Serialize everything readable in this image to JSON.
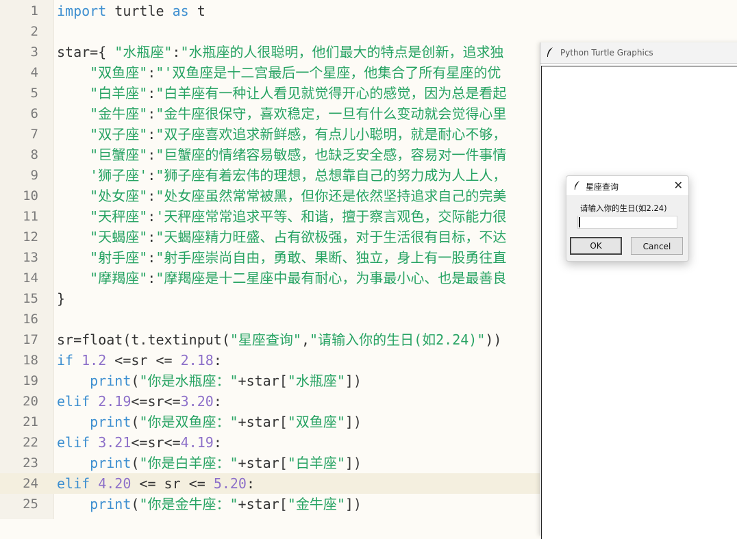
{
  "editor": {
    "lines": [
      {
        "num": "1",
        "segs": [
          {
            "t": "import",
            "c": "k"
          },
          {
            "t": " turtle ",
            "c": "p"
          },
          {
            "t": "as",
            "c": "k"
          },
          {
            "t": " t",
            "c": "p"
          }
        ]
      },
      {
        "num": "2",
        "segs": []
      },
      {
        "num": "3",
        "segs": [
          {
            "t": "star={ ",
            "c": "p"
          },
          {
            "t": "\"水瓶座\"",
            "c": "s"
          },
          {
            "t": ":",
            "c": "p"
          },
          {
            "t": "\"水瓶座的人很聪明，他们最大的特点是创新，追求独",
            "c": "s"
          }
        ]
      },
      {
        "num": "4",
        "segs": [
          {
            "t": "    ",
            "c": "p"
          },
          {
            "t": "\"双鱼座\"",
            "c": "s"
          },
          {
            "t": ":",
            "c": "p"
          },
          {
            "t": "\"'双鱼座是十二宫最后一个星座，他集合了所有星座的优",
            "c": "s"
          }
        ]
      },
      {
        "num": "5",
        "segs": [
          {
            "t": "    ",
            "c": "p"
          },
          {
            "t": "\"白羊座\"",
            "c": "s"
          },
          {
            "t": ":",
            "c": "p"
          },
          {
            "t": "\"白羊座有一种让人看见就觉得开心的感觉，因为总是看起",
            "c": "s"
          }
        ]
      },
      {
        "num": "6",
        "segs": [
          {
            "t": "    ",
            "c": "p"
          },
          {
            "t": "\"金牛座\"",
            "c": "s"
          },
          {
            "t": ":",
            "c": "p"
          },
          {
            "t": "\"金牛座很保守，喜欢稳定，一旦有什么变动就会觉得心里",
            "c": "s"
          }
        ]
      },
      {
        "num": "7",
        "segs": [
          {
            "t": "    ",
            "c": "p"
          },
          {
            "t": "\"双子座\"",
            "c": "s"
          },
          {
            "t": ":",
            "c": "p"
          },
          {
            "t": "\"双子座喜欢追求新鲜感，有点儿小聪明，就是耐心不够，",
            "c": "s"
          }
        ]
      },
      {
        "num": "8",
        "segs": [
          {
            "t": "    ",
            "c": "p"
          },
          {
            "t": "\"巨蟹座\"",
            "c": "s"
          },
          {
            "t": ":",
            "c": "p"
          },
          {
            "t": "\"巨蟹座的情绪容易敏感，也缺乏安全感，容易对一件事情",
            "c": "s"
          }
        ]
      },
      {
        "num": "9",
        "segs": [
          {
            "t": "    ",
            "c": "p"
          },
          {
            "t": "'狮子座'",
            "c": "s"
          },
          {
            "t": ":",
            "c": "p"
          },
          {
            "t": "\"狮子座有着宏伟的理想，总想靠自己的努力成为人上人，",
            "c": "s"
          }
        ]
      },
      {
        "num": "10",
        "segs": [
          {
            "t": "    ",
            "c": "p"
          },
          {
            "t": "\"处女座\"",
            "c": "s"
          },
          {
            "t": ":",
            "c": "p"
          },
          {
            "t": "\"处女座虽然常常被黑，但你还是依然坚持追求自己的完美",
            "c": "s"
          }
        ]
      },
      {
        "num": "11",
        "segs": [
          {
            "t": "    ",
            "c": "p"
          },
          {
            "t": "\"天秤座\"",
            "c": "s"
          },
          {
            "t": ":",
            "c": "p"
          },
          {
            "t": "'天秤座常常追求平等、和谐，擅于察言观色，交际能力很",
            "c": "s"
          }
        ]
      },
      {
        "num": "12",
        "segs": [
          {
            "t": "    ",
            "c": "p"
          },
          {
            "t": "\"天蝎座\"",
            "c": "s"
          },
          {
            "t": ":",
            "c": "p"
          },
          {
            "t": "\"天蝎座精力旺盛、占有欲极强，对于生活很有目标，不达",
            "c": "s"
          }
        ]
      },
      {
        "num": "13",
        "segs": [
          {
            "t": "    ",
            "c": "p"
          },
          {
            "t": "\"射手座\"",
            "c": "s"
          },
          {
            "t": ":",
            "c": "p"
          },
          {
            "t": "\"射手座崇尚自由，勇敢、果断、独立，身上有一股勇往直",
            "c": "s"
          }
        ]
      },
      {
        "num": "14",
        "segs": [
          {
            "t": "    ",
            "c": "p"
          },
          {
            "t": "\"摩羯座\"",
            "c": "s"
          },
          {
            "t": ":",
            "c": "p"
          },
          {
            "t": "\"摩羯座是十二星座中最有耐心，为事最小心、也是最善良",
            "c": "s"
          }
        ]
      },
      {
        "num": "15",
        "segs": [
          {
            "t": "}",
            "c": "p"
          }
        ]
      },
      {
        "num": "16",
        "segs": []
      },
      {
        "num": "17",
        "segs": [
          {
            "t": "sr=",
            "c": "p"
          },
          {
            "t": "float",
            "c": "f"
          },
          {
            "t": "(t.textinput(",
            "c": "p"
          },
          {
            "t": "\"星座查询\"",
            "c": "s"
          },
          {
            "t": ",",
            "c": "p"
          },
          {
            "t": "\"请输入你的生日(如2.24)\"",
            "c": "s"
          },
          {
            "t": "))",
            "c": "p"
          }
        ]
      },
      {
        "num": "18",
        "segs": [
          {
            "t": "if",
            "c": "k"
          },
          {
            "t": " ",
            "c": "p"
          },
          {
            "t": "1.2",
            "c": "n"
          },
          {
            "t": " <=sr <= ",
            "c": "p"
          },
          {
            "t": "2.18",
            "c": "n"
          },
          {
            "t": ":",
            "c": "p"
          }
        ]
      },
      {
        "num": "19",
        "segs": [
          {
            "t": "    ",
            "c": "p"
          },
          {
            "t": "print",
            "c": "k"
          },
          {
            "t": "(",
            "c": "p"
          },
          {
            "t": "\"你是水瓶座：\"",
            "c": "s"
          },
          {
            "t": "+star[",
            "c": "p"
          },
          {
            "t": "\"水瓶座\"",
            "c": "s"
          },
          {
            "t": "])",
            "c": "p"
          }
        ]
      },
      {
        "num": "20",
        "segs": [
          {
            "t": "elif",
            "c": "k"
          },
          {
            "t": " ",
            "c": "p"
          },
          {
            "t": "2.19",
            "c": "n"
          },
          {
            "t": "<=sr<=",
            "c": "p"
          },
          {
            "t": "3.20",
            "c": "n"
          },
          {
            "t": ":",
            "c": "p"
          }
        ]
      },
      {
        "num": "21",
        "segs": [
          {
            "t": "    ",
            "c": "p"
          },
          {
            "t": "print",
            "c": "k"
          },
          {
            "t": "(",
            "c": "p"
          },
          {
            "t": "\"你是双鱼座：\"",
            "c": "s"
          },
          {
            "t": "+star[",
            "c": "p"
          },
          {
            "t": "\"双鱼座\"",
            "c": "s"
          },
          {
            "t": "])",
            "c": "p"
          }
        ]
      },
      {
        "num": "22",
        "segs": [
          {
            "t": "elif",
            "c": "k"
          },
          {
            "t": " ",
            "c": "p"
          },
          {
            "t": "3.21",
            "c": "n"
          },
          {
            "t": "<=sr<=",
            "c": "p"
          },
          {
            "t": "4.19",
            "c": "n"
          },
          {
            "t": ":",
            "c": "p"
          }
        ]
      },
      {
        "num": "23",
        "segs": [
          {
            "t": "    ",
            "c": "p"
          },
          {
            "t": "print",
            "c": "k"
          },
          {
            "t": "(",
            "c": "p"
          },
          {
            "t": "\"你是白羊座：\"",
            "c": "s"
          },
          {
            "t": "+star[",
            "c": "p"
          },
          {
            "t": "\"白羊座\"",
            "c": "s"
          },
          {
            "t": "])",
            "c": "p"
          }
        ]
      },
      {
        "num": "24",
        "segs": [
          {
            "t": "elif",
            "c": "k"
          },
          {
            "t": " ",
            "c": "p"
          },
          {
            "t": "4.20",
            "c": "n"
          },
          {
            "t": " <= sr <= ",
            "c": "p"
          },
          {
            "t": "5.20",
            "c": "n"
          },
          {
            "t": ":",
            "c": "p"
          }
        ],
        "current": true
      },
      {
        "num": "25",
        "segs": [
          {
            "t": "    ",
            "c": "p"
          },
          {
            "t": "print",
            "c": "k"
          },
          {
            "t": "(",
            "c": "p"
          },
          {
            "t": "\"你是金牛座：\"",
            "c": "s"
          },
          {
            "t": "+star[",
            "c": "p"
          },
          {
            "t": "\"金牛座\"",
            "c": "s"
          },
          {
            "t": "])",
            "c": "p"
          }
        ]
      }
    ]
  },
  "turtle_window": {
    "title": "Python Turtle Graphics"
  },
  "dialog": {
    "title": "星座查询",
    "prompt": "请输入你的生日(如2.24)",
    "input_value": "",
    "ok_label": "OK",
    "cancel_label": "Cancel",
    "close_glyph": "✕"
  },
  "icons": {
    "feather": "feather-icon",
    "close": "close-icon"
  },
  "colors": {
    "keyword": "#3d8fd0",
    "string": "#27a363",
    "number": "#8d70c9",
    "background": "#fdfbf6"
  }
}
